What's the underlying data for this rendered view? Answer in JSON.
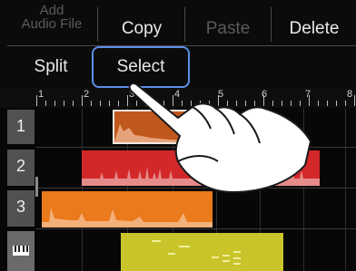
{
  "menu": {
    "add_audio_file": "Add\nAudio File",
    "copy": "Copy",
    "paste": "Paste",
    "delete": "Delete",
    "split": "Split",
    "select": "Select"
  },
  "ruler": {
    "marks": [
      "1",
      "2",
      "3",
      "4",
      "5",
      "6",
      "7",
      "8"
    ]
  },
  "tracks": [
    {
      "label": "1"
    },
    {
      "label": "2"
    },
    {
      "label": "3"
    },
    {
      "label": "",
      "icon": "keyboard-icon"
    }
  ],
  "colors": {
    "highlight": "#5b8fe6",
    "track1_region": "#c0581e",
    "track2_region": "#d3282a",
    "track3_region": "#ea7a1c",
    "track4_region": "#c8c42a"
  }
}
